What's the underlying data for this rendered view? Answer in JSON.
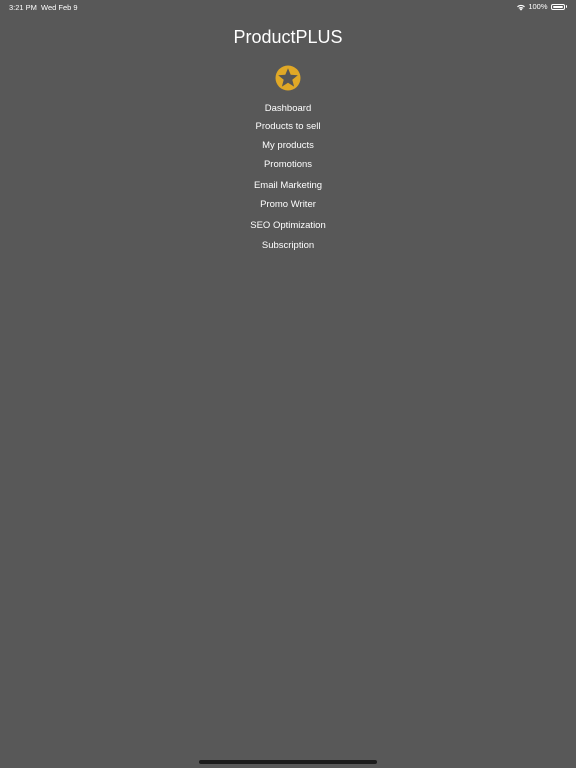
{
  "status_bar": {
    "time": "3:21 PM",
    "date": "Wed Feb 9",
    "battery_percent": "100%",
    "icons": [
      "wifi-icon",
      "battery-icon"
    ]
  },
  "app": {
    "title": "ProductPLUS",
    "logo_icon": "star-badge-icon",
    "logo_color": "#E0A826",
    "background_color": "#585858"
  },
  "menu": {
    "items": [
      {
        "label": "Dashboard"
      },
      {
        "label": "Products to sell"
      },
      {
        "label": "My products"
      },
      {
        "label": "Promotions"
      },
      {
        "label": "Email Marketing"
      },
      {
        "label": "Promo Writer"
      },
      {
        "label": "SEO Optimization"
      },
      {
        "label": "Subscription"
      }
    ]
  }
}
